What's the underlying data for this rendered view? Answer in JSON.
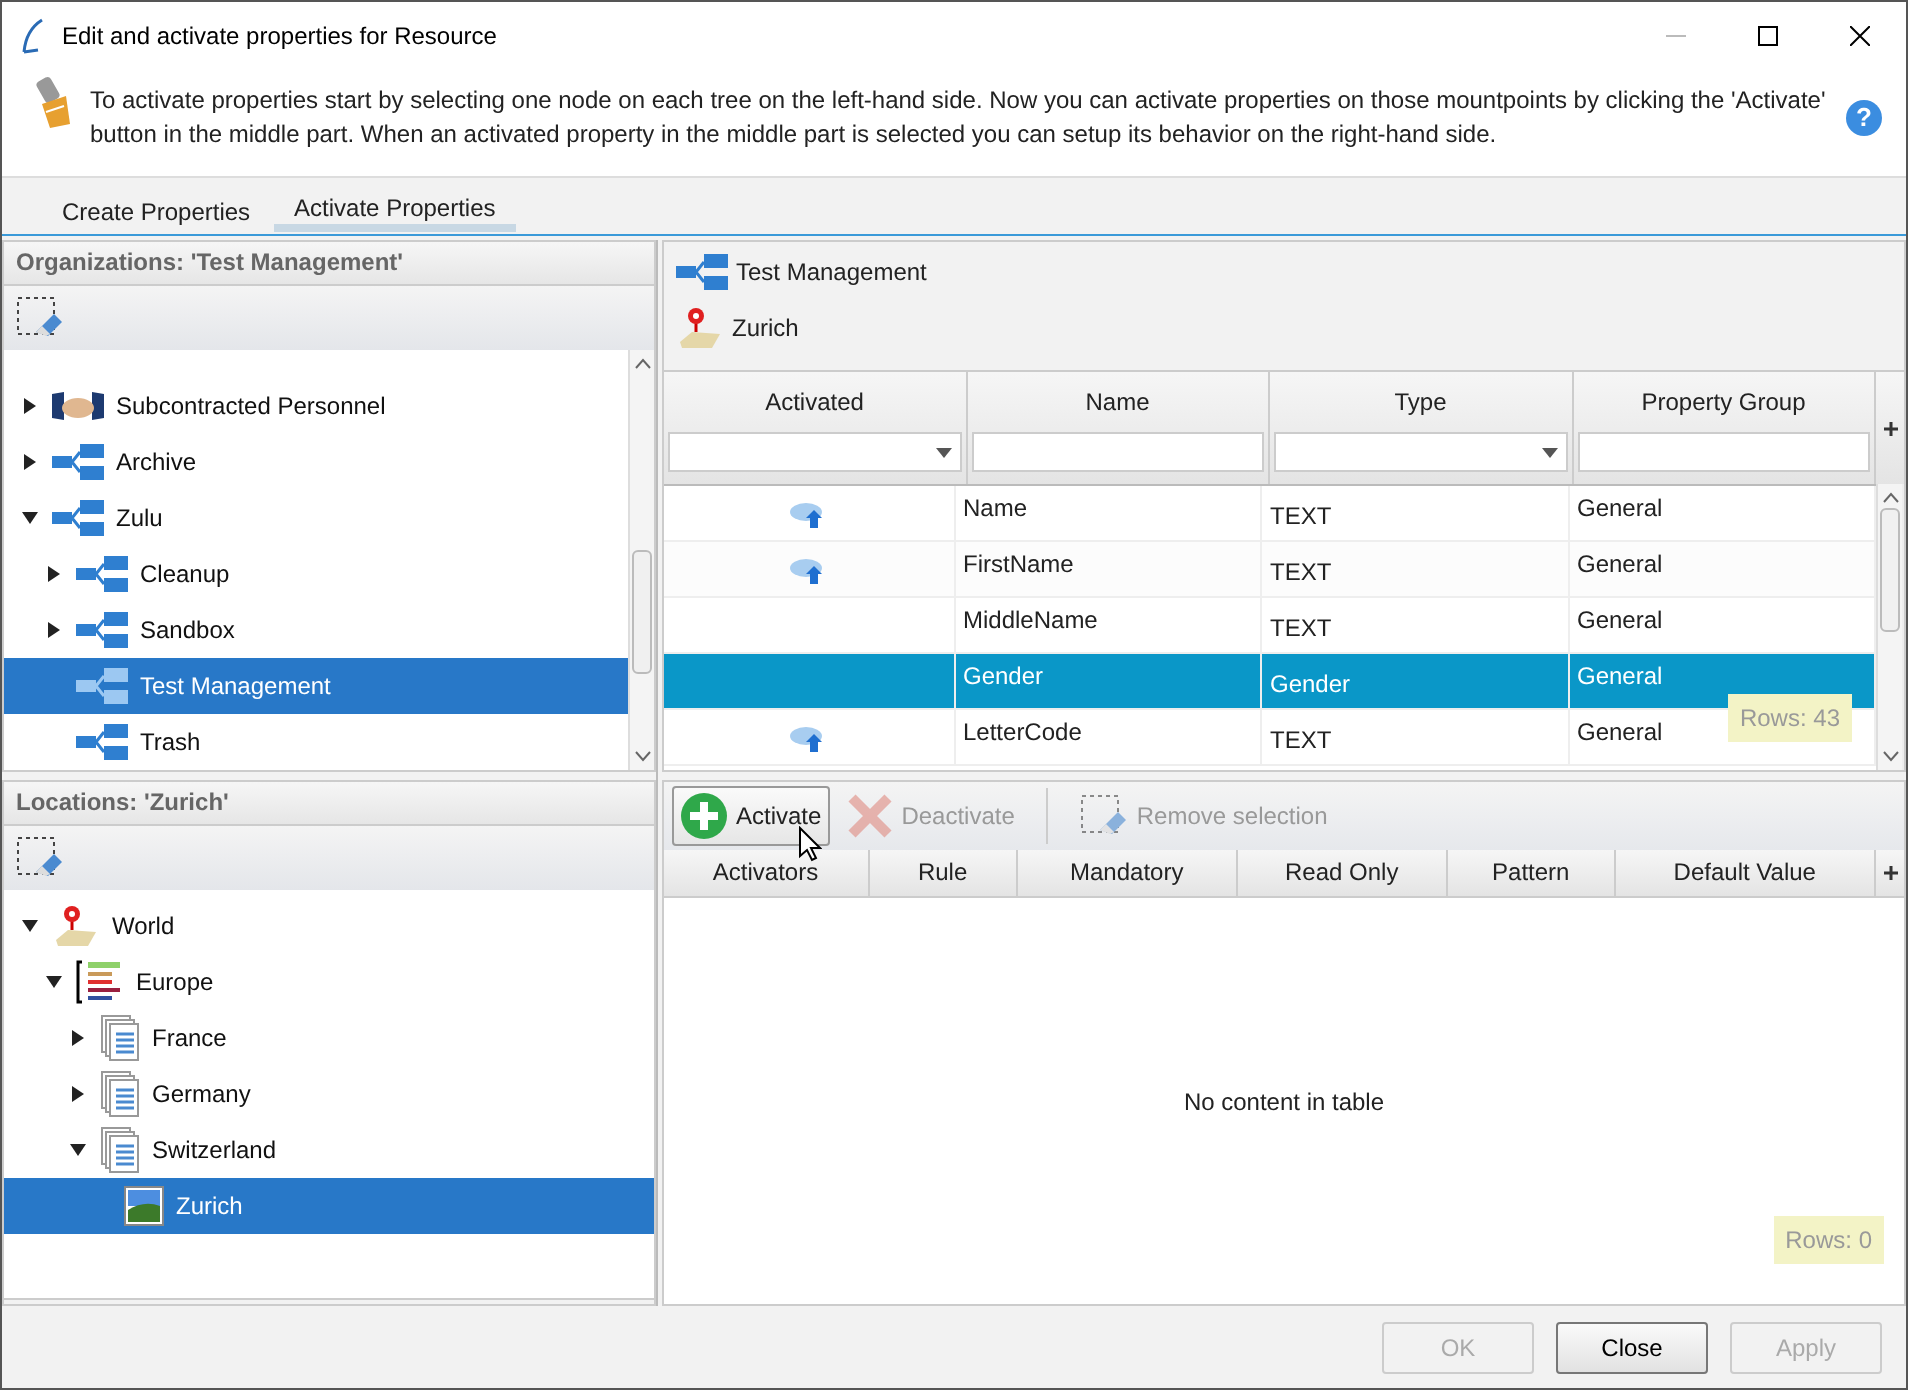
{
  "window": {
    "title": "Edit and activate properties for Resource"
  },
  "help": {
    "symbol": "?"
  },
  "info": {
    "text": "To activate properties start by selecting one node on each tree on the left-hand side. Now you can activate properties on those mountpoints by clicking the 'Activate' button in the middle part. When an activated property in the middle part is selected you can setup its behavior on the right-hand side."
  },
  "tabs": [
    {
      "label": "Create Properties",
      "selected": false
    },
    {
      "label": "Activate Properties",
      "selected": true
    }
  ],
  "org_panel": {
    "title": "Organizations: 'Test Management'",
    "tree": [
      {
        "label": "Subcontracted Personnel",
        "kind": "partner",
        "expandable": true,
        "expanded": false,
        "selected": false
      },
      {
        "label": "Archive",
        "kind": "org",
        "expandable": true,
        "expanded": false,
        "selected": false
      },
      {
        "label": "Zulu",
        "kind": "org",
        "expandable": true,
        "expanded": true,
        "selected": false,
        "children": [
          {
            "label": "Cleanup",
            "kind": "org",
            "expandable": true,
            "expanded": false,
            "selected": false
          },
          {
            "label": "Sandbox",
            "kind": "org",
            "expandable": true,
            "expanded": false,
            "selected": false
          },
          {
            "label": "Test Management",
            "kind": "org",
            "selected": true
          },
          {
            "label": "Trash",
            "kind": "org",
            "selected": false
          }
        ]
      }
    ]
  },
  "location_panel": {
    "title": "Locations: 'Zurich'",
    "tree": [
      {
        "label": "World",
        "kind": "pin",
        "expandable": true,
        "expanded": true,
        "selected": false,
        "children": [
          {
            "label": "Europe",
            "kind": "region",
            "expandable": true,
            "expanded": true,
            "selected": false,
            "children": [
              {
                "label": "France",
                "kind": "pages",
                "expandable": true,
                "expanded": false,
                "selected": false
              },
              {
                "label": "Germany",
                "kind": "pages",
                "expandable": true,
                "expanded": false,
                "selected": false
              },
              {
                "label": "Switzerland",
                "kind": "pages",
                "expandable": true,
                "expanded": true,
                "selected": false,
                "children": [
                  {
                    "label": "Zurich",
                    "kind": "picture",
                    "selected": true
                  }
                ]
              }
            ]
          }
        ]
      }
    ]
  },
  "mountpoints": [
    {
      "label": "Test Management",
      "kind": "org"
    },
    {
      "label": "Zurich",
      "kind": "pin"
    }
  ],
  "properties_table": {
    "columns": [
      {
        "label": "Activated",
        "kind": "dropdown"
      },
      {
        "label": "Name",
        "kind": "text"
      },
      {
        "label": "Type",
        "kind": "dropdown"
      },
      {
        "label": "Property Group",
        "kind": "text"
      }
    ],
    "rows": [
      {
        "activated": true,
        "name": "Name",
        "type": "TEXT",
        "group": "General",
        "selected": false
      },
      {
        "activated": true,
        "name": "FirstName",
        "type": "TEXT",
        "group": "General",
        "selected": false
      },
      {
        "activated": false,
        "name": "MiddleName",
        "type": "TEXT",
        "group": "General",
        "selected": false
      },
      {
        "activated": false,
        "name": "Gender",
        "type": "Gender",
        "group": "General",
        "selected": true
      },
      {
        "activated": true,
        "name": "LetterCode",
        "type": "TEXT",
        "group": "General",
        "selected": false
      }
    ],
    "row_count": "Rows: 43"
  },
  "toolbar": [
    {
      "label": "Activate",
      "kind": "add",
      "disabled": false
    },
    {
      "label": "Deactivate",
      "kind": "remove",
      "disabled": true
    },
    {
      "label": "Remove selection",
      "kind": "clear",
      "disabled": true
    }
  ],
  "behavior_table": {
    "columns": [
      "Activators",
      "Rule",
      "Mandatory",
      "Read Only",
      "Pattern",
      "Default Value"
    ],
    "empty_text": "No content in table",
    "row_count": "Rows: 0"
  },
  "footer_buttons": [
    {
      "label": "OK",
      "disabled": true
    },
    {
      "label": "Close",
      "disabled": false
    },
    {
      "label": "Apply",
      "disabled": true
    }
  ]
}
